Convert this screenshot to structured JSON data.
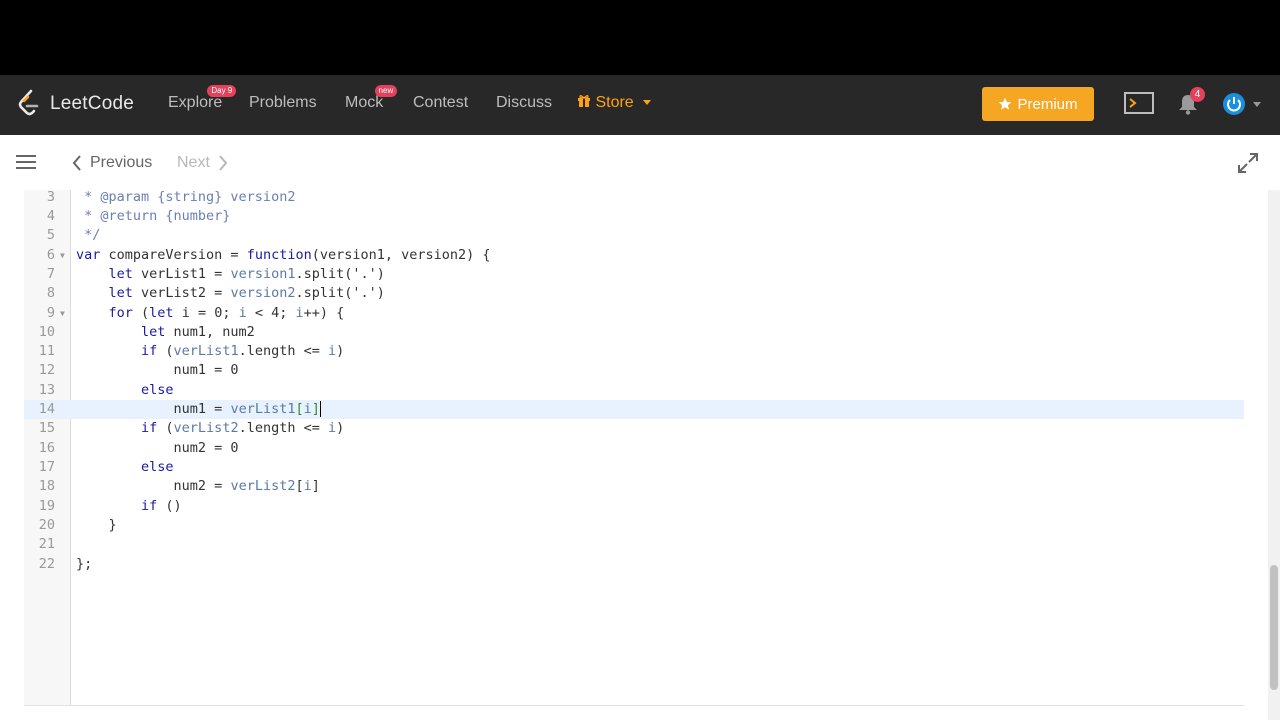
{
  "nav": {
    "logo_text": "LeetCode",
    "items": [
      {
        "label": "Explore",
        "badge": "Day 9"
      },
      {
        "label": "Problems"
      },
      {
        "label": "Mock",
        "badge": "new"
      },
      {
        "label": "Contest"
      },
      {
        "label": "Discuss"
      },
      {
        "label": "Store"
      }
    ],
    "premium_label": "Premium",
    "notification_count": "4"
  },
  "toolbar": {
    "previous_label": "Previous",
    "next_label": "Next"
  },
  "editor": {
    "active_line": 14,
    "lines": [
      {
        "n": "3"
      },
      {
        "n": "4"
      },
      {
        "n": "5"
      },
      {
        "n": "6"
      },
      {
        "n": "7"
      },
      {
        "n": "8"
      },
      {
        "n": "9"
      },
      {
        "n": "10"
      },
      {
        "n": "11"
      },
      {
        "n": "12"
      },
      {
        "n": "13"
      },
      {
        "n": "14"
      },
      {
        "n": "15"
      },
      {
        "n": "16"
      },
      {
        "n": "17"
      },
      {
        "n": "18"
      },
      {
        "n": "19"
      },
      {
        "n": "20"
      },
      {
        "n": "21"
      },
      {
        "n": "22"
      }
    ],
    "code": {
      "l3": " * @param {string} version2",
      "l4": " * @return {number}",
      "l5": " */",
      "l6_a": "var",
      "l6_b": " compareVersion = ",
      "l6_c": "function",
      "l6_d": "(version1, version2) {",
      "l7_a": "    let",
      "l7_b": " verList1 = ",
      "l7_c": "version1",
      "l7_d": ".split('.')",
      "l8_a": "    let",
      "l8_b": " verList2 = ",
      "l8_c": "version2",
      "l8_d": ".split('.')",
      "l9_a": "    for",
      "l9_b": " (",
      "l9_c": "let",
      "l9_d": " i = 0; ",
      "l9_e": "i",
      "l9_f": " < 4; ",
      "l9_g": "i",
      "l9_h": "++) {",
      "l10_a": "        let",
      "l10_b": " num1, num2",
      "l11_a": "        if",
      "l11_b": " (",
      "l11_c": "verList1",
      "l11_d": ".length <= ",
      "l11_e": "i",
      "l11_f": ")",
      "l12": "            num1 = 0",
      "l13": "        else",
      "l14_a": "            num1 = ",
      "l14_b": "verList1",
      "l14_c": "[",
      "l14_d": "i",
      "l14_e": "]",
      "l15_a": "        if",
      "l15_b": " (",
      "l15_c": "verList2",
      "l15_d": ".length <= ",
      "l15_e": "i",
      "l15_f": ")",
      "l16": "            num2 = 0",
      "l17": "        else",
      "l18_a": "            num2 = ",
      "l18_b": "verList2",
      "l18_c": "[",
      "l18_d": "i",
      "l18_e": "]",
      "l19_a": "        if",
      "l19_b": " ()",
      "l20": "    }",
      "l21": "",
      "l22": "};"
    }
  },
  "colors": {
    "accent": "#ffa116",
    "premium": "#f5a623",
    "badge": "#e4425c",
    "navbar": "#282828"
  }
}
